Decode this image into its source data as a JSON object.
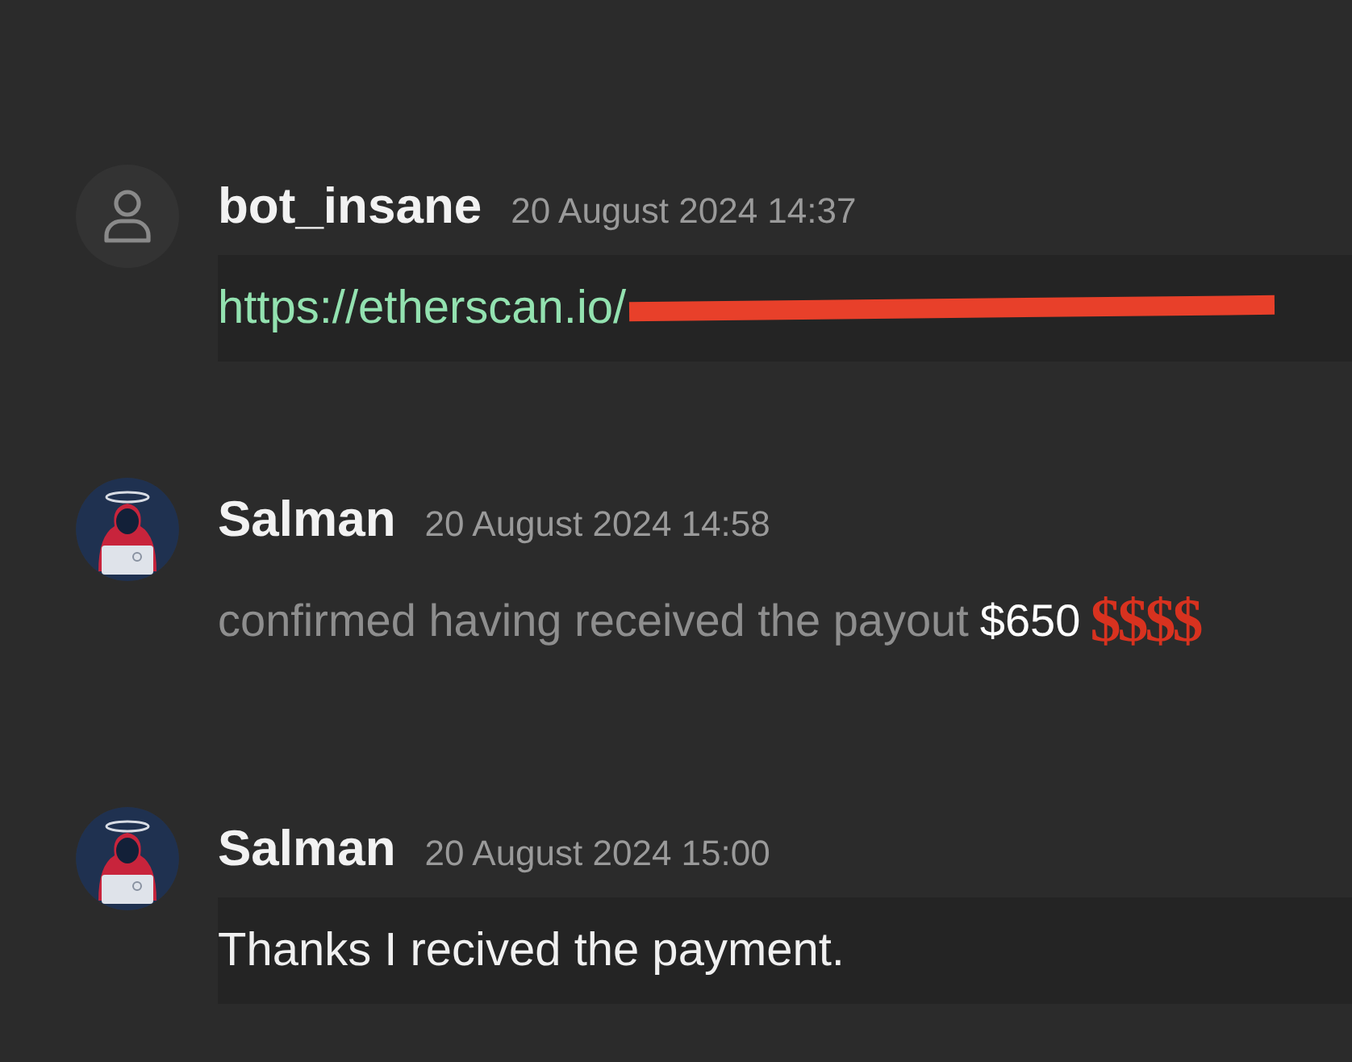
{
  "messages": [
    {
      "author": "bot_insane",
      "time": "20 August 2024 14:37",
      "avatar": {
        "kind": "default"
      },
      "boxed": true,
      "body": {
        "kind": "link",
        "text": "https://etherscan.io/",
        "redacted": true
      }
    },
    {
      "author": "Salman",
      "time": "20 August 2024 14:58",
      "avatar": {
        "kind": "hooded"
      },
      "boxed": false,
      "body": {
        "kind": "text",
        "text": "confirmed having received the payout",
        "amount": "$650",
        "sticker": "$$$$"
      }
    },
    {
      "author": "Salman",
      "time": "20 August 2024 15:00",
      "avatar": {
        "kind": "hooded"
      },
      "boxed": true,
      "body": {
        "kind": "plain",
        "text": "Thanks I recived the payment."
      }
    }
  ]
}
